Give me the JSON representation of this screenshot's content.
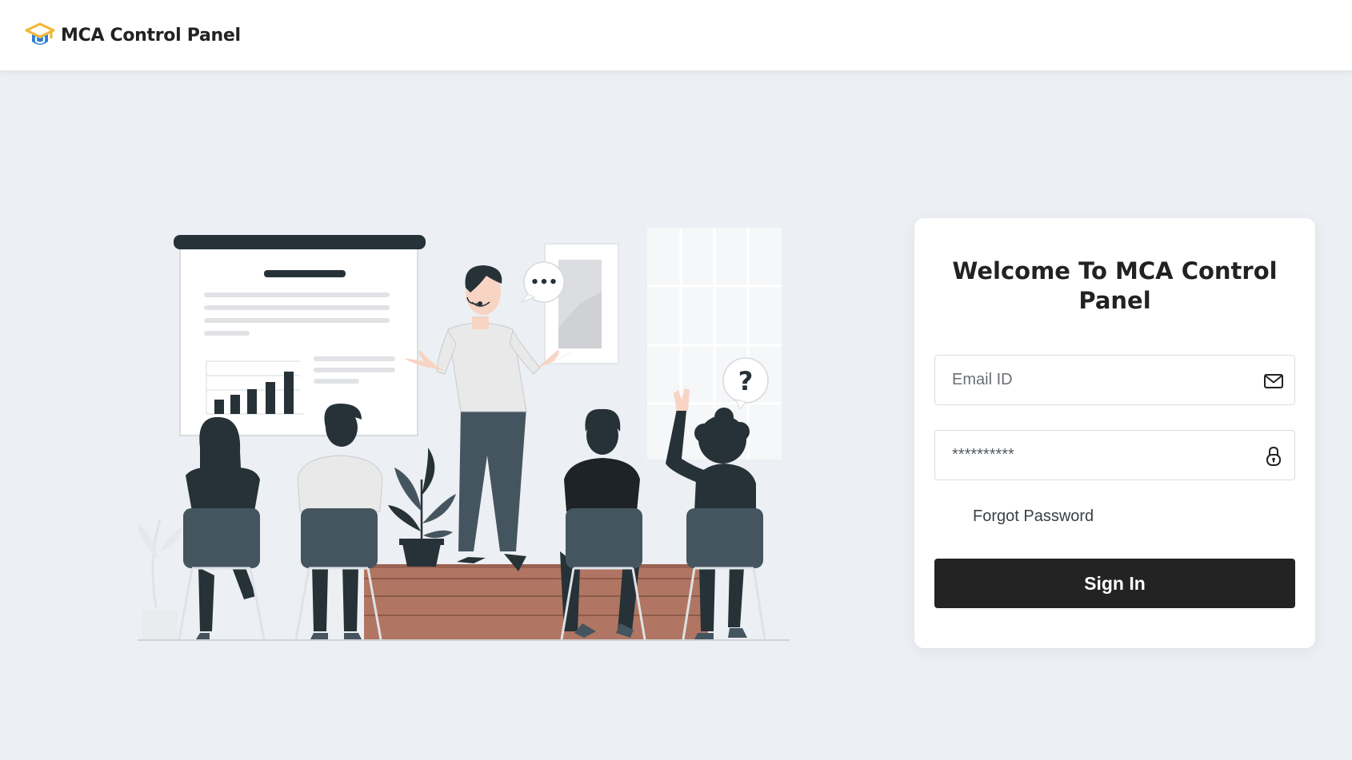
{
  "header": {
    "brand_name": "MCA Control Panel",
    "logo_icon": "graduation-cap-icon"
  },
  "illustration": {
    "question_mark": "?",
    "speech_bubble_text": "•••"
  },
  "login": {
    "title": "Welcome To MCA Control Panel",
    "email_placeholder": "Email ID",
    "email_value": "",
    "email_icon": "envelope-icon",
    "password_value": "**********",
    "password_icon": "lock-icon",
    "forgot_password_label": "Forgot Password",
    "sign_in_label": "Sign In"
  },
  "colors": {
    "page_background": "#eceff3",
    "card_background": "#ffffff",
    "button_background": "#232323",
    "logo_yellow": "#f2b632",
    "logo_blue": "#2f7fd6",
    "stage_brown": "#b07663",
    "chair_slate": "#455560"
  }
}
